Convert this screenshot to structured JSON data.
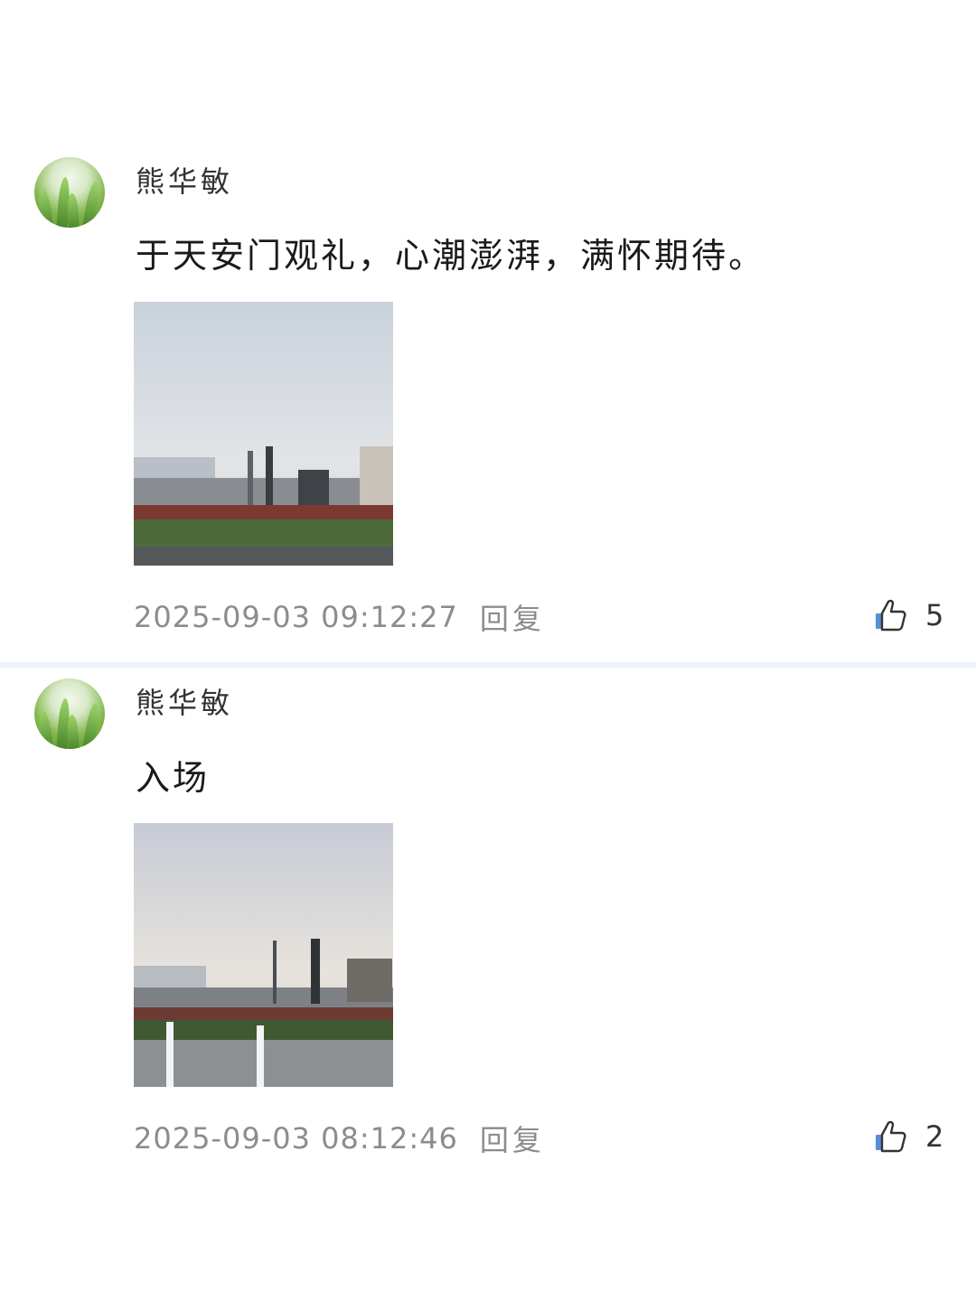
{
  "comments": [
    {
      "username": "熊华敏",
      "text": "于天安门观礼，心潮澎湃，满怀期待。",
      "timestamp": "2025-09-03 09:12:27",
      "reply_label": "回复",
      "like_count": "5",
      "like_icon": "thumbs-up-icon",
      "avatar_icon": "grass-avatar"
    },
    {
      "username": "熊华敏",
      "text": "入场",
      "timestamp": "2025-09-03 08:12:46",
      "reply_label": "回复",
      "like_count": "2",
      "like_icon": "thumbs-up-icon",
      "avatar_icon": "grass-avatar"
    }
  ],
  "colors": {
    "divider": "#eef3f9",
    "meta_text": "#8c8c8c",
    "like_icon_accent": "#5a8fd8"
  }
}
